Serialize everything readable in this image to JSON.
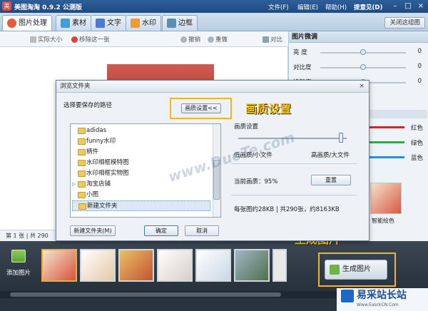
{
  "titlebar": {
    "title": "美图淘淘 0.9.2 公测版",
    "menu": [
      "文件(F)",
      "编辑(E)",
      "帮助(H)",
      "提意见(D)"
    ]
  },
  "tabs": [
    {
      "label": "图片处理",
      "color": "#e9583c"
    },
    {
      "label": "素材",
      "color": "#3f9fd8"
    },
    {
      "label": "文字",
      "color": "#4c7ad2"
    },
    {
      "label": "水印",
      "color": "#f29a2b"
    },
    {
      "label": "边框",
      "color": "#5a8fb3"
    }
  ],
  "close_thumbs": "关闭这组图",
  "toolbar": {
    "actual_size": "实际大小",
    "remove": "移除这一张",
    "undo": "撤销",
    "redo": "重做",
    "compare": "对比"
  },
  "status": {
    "text": "第 1 张 | 共 290"
  },
  "right_panel": {
    "title": "图片微调",
    "sliders": [
      {
        "label": "亮 度",
        "value": "0",
        "level": 0.5
      },
      {
        "label": "对比度",
        "value": "0",
        "level": 0.5
      },
      {
        "label": "饱和度",
        "value": "0",
        "level": 0.5
      }
    ],
    "colors": [
      {
        "label": "红色",
        "color": "#cc2a2a"
      },
      {
        "label": "绿色",
        "color": "#2fa84a"
      },
      {
        "label": "蓝色",
        "color": "#2b8fd6"
      }
    ],
    "preset_caption": "智能绘色"
  },
  "thumbs": {
    "add_label": "添加图片",
    "items": [
      "thumb-1",
      "thumb-2",
      "thumb-3",
      "thumb-4",
      "thumb-5",
      "thumb-6",
      "thumb-7"
    ]
  },
  "generate": {
    "label": "生成图片",
    "callout": "生成图片"
  },
  "dialog": {
    "title": "浏览文件夹",
    "path_label": "选择要保存的路径",
    "quality_button": "画质设置<<",
    "quality_callout": "画质设置",
    "folders": [
      {
        "name": "adidas",
        "expandable": false
      },
      {
        "name": "funny水印",
        "expandable": false
      },
      {
        "name": "柄件",
        "expandable": false
      },
      {
        "name": "水印相框模特图",
        "expandable": false
      },
      {
        "name": "水印相框实物图",
        "expandable": false
      },
      {
        "name": "淘宝店铺",
        "expandable": true
      },
      {
        "name": "小图",
        "expandable": false
      },
      {
        "name": "新建文件夹",
        "expandable": false,
        "selected": true
      }
    ],
    "new_folder": "新建文件夹(M)",
    "ok": "确定",
    "cancel": "取消",
    "quality": {
      "heading": "画质设置",
      "low": "低画质/小文件",
      "high": "高画质/大文件",
      "current": "当前画质：95%",
      "reset": "重置",
      "level": 0.95,
      "info": "每张图约28KB | 共290张，约8163KB"
    }
  },
  "watermark": "www.DuoTe.com",
  "site_logo": {
    "name": "易采站长站",
    "sub": "Www.EasckCN.Com"
  }
}
